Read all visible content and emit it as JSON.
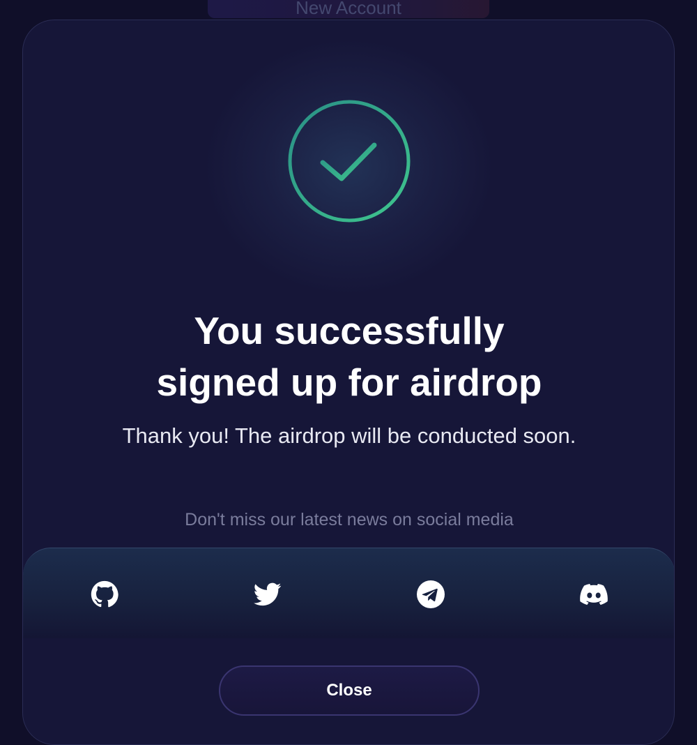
{
  "background": {
    "button_label": "New Account"
  },
  "modal": {
    "icon": "check-circle-icon",
    "title_line1": "You successfully",
    "title_line2": "signed up for airdrop",
    "subtitle": "Thank you! The airdrop will be conducted soon.",
    "social_hint": "Don't miss our latest news on social media",
    "social_links": [
      {
        "name": "GitHub",
        "icon": "github-icon"
      },
      {
        "name": "Twitter",
        "icon": "twitter-icon"
      },
      {
        "name": "Telegram",
        "icon": "telegram-icon"
      },
      {
        "name": "Discord",
        "icon": "discord-icon"
      }
    ],
    "close_label": "Close"
  },
  "colors": {
    "background": "#100f29",
    "modal": "#181839",
    "accent_green": "#3fc68e",
    "accent_teal": "#2a8f86",
    "text_primary": "#ffffff",
    "text_muted": "#7a7c9c"
  }
}
